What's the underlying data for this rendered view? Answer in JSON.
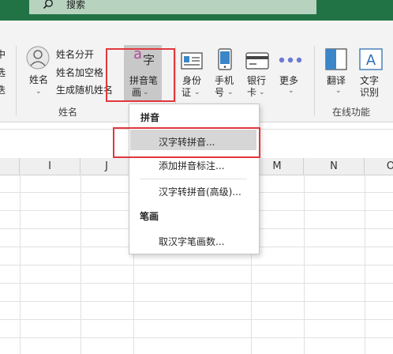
{
  "title_bar": {
    "search_placeholder": "搜索"
  },
  "ribbon": {
    "left_partial": [
      "中",
      "选",
      "迭"
    ],
    "name_button": "姓名",
    "name_small": [
      "姓名分开",
      "姓名加空格",
      "生成随机姓名"
    ],
    "pinyin_icon_letters": {
      "a": "a",
      "zi": "字"
    },
    "pinyin_button": [
      "拼音笔",
      "画"
    ],
    "id_button": [
      "身份",
      "证"
    ],
    "phone_button": [
      "手机",
      "号"
    ],
    "bank_button": [
      "银行",
      "卡"
    ],
    "more_button": "更多",
    "translate_button": "翻译",
    "ocr_button": [
      "文字",
      "识别"
    ],
    "group_name": "姓名",
    "group_online": "在线功能"
  },
  "columns": [
    "I",
    "J",
    "M",
    "N",
    "O"
  ],
  "menu": {
    "section1": "拼音",
    "items1": [
      "汉字转拼音...",
      "添加拼音标注...",
      "汉字转拼音(高级)..."
    ],
    "section2": "笔画",
    "items2": [
      "取汉字笔画数..."
    ]
  },
  "colors": {
    "excel_green": "#217346",
    "highlight_red": "#e0383e",
    "menu_hover": "#d6d6d6"
  }
}
